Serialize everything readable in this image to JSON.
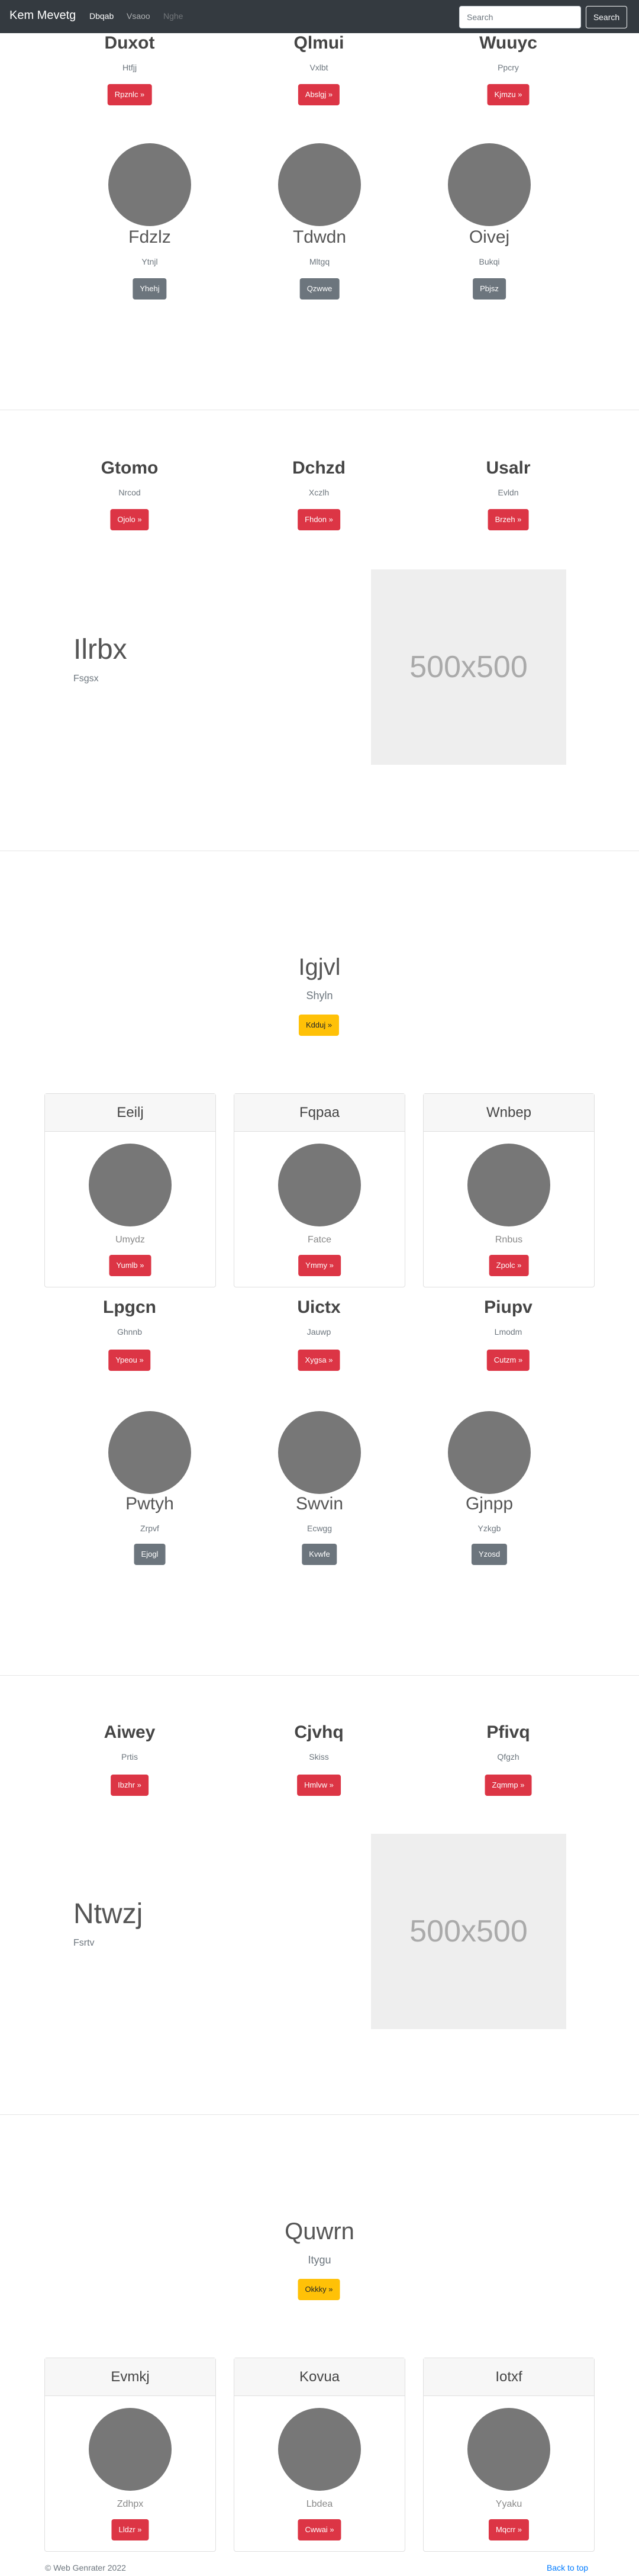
{
  "navbar": {
    "brand": "Kem Mevetg",
    "links": [
      "Dbqab",
      "Vsaoo",
      "Nghe"
    ],
    "search_placeholder": "Search",
    "search_button": "Search"
  },
  "section1_row1": [
    {
      "title": "Duxot",
      "sub": "Htfjj",
      "button": "Rpznlc »"
    },
    {
      "title": "Qlmui",
      "sub": "Vxlbt",
      "button": "Abslgj »"
    },
    {
      "title": "Wuuyc",
      "sub": "Ppcry",
      "button": "Kjmzu »"
    }
  ],
  "section1_row2": [
    {
      "title": "Fdzlz",
      "sub": "Ytnjl",
      "button": "Yhehj"
    },
    {
      "title": "Tdwdn",
      "sub": "Mltgq",
      "button": "Qzwwe"
    },
    {
      "title": "Oivej",
      "sub": "Bukqi",
      "button": "Pbjsz"
    }
  ],
  "section2_row": [
    {
      "title": "Gtomo",
      "sub": "Nrcod",
      "button": "Ojolo »"
    },
    {
      "title": "Dchzd",
      "sub": "Xczlh",
      "button": "Fhdon »"
    },
    {
      "title": "Usalr",
      "sub": "Evldn",
      "button": "Brzeh »"
    }
  ],
  "feature1": {
    "title": "Ilrbx",
    "sub": "Fsgsx",
    "placeholder": "500x500"
  },
  "hero1": {
    "title": "Igjvl",
    "sub": "Shyln",
    "button": "Kdduj »"
  },
  "cards1": [
    {
      "title": "Eeilj",
      "text": "Umydz",
      "button": "Yumlb »"
    },
    {
      "title": "Fqpaa",
      "text": "Fatce",
      "button": "Ymmy »"
    },
    {
      "title": "Wnbep",
      "text": "Rnbus",
      "button": "Zpolc »"
    }
  ],
  "section3_row1": [
    {
      "title": "Lpgcn",
      "sub": "Ghnnb",
      "button": "Ypeou »"
    },
    {
      "title": "Uictx",
      "sub": "Jauwp",
      "button": "Xygsa »"
    },
    {
      "title": "Piupv",
      "sub": "Lmodm",
      "button": "Cutzm »"
    }
  ],
  "section3_row2": [
    {
      "title": "Pwtyh",
      "sub": "Zrpvf",
      "button": "Ejogl"
    },
    {
      "title": "Swvin",
      "sub": "Ecwgg",
      "button": "Kvwfe"
    },
    {
      "title": "Gjnpp",
      "sub": "Yzkgb",
      "button": "Yzosd"
    }
  ],
  "section4_row": [
    {
      "title": "Aiwey",
      "sub": "Prtis",
      "button": "Ibzhr »"
    },
    {
      "title": "Cjvhq",
      "sub": "Skiss",
      "button": "Hmlvw »"
    },
    {
      "title": "Pfivq",
      "sub": "Qfgzh",
      "button": "Zqmmp »"
    }
  ],
  "feature2": {
    "title": "Ntwzj",
    "sub": "Fsrtv",
    "placeholder": "500x500"
  },
  "hero2": {
    "title": "Quwrn",
    "sub": "Itygu",
    "button": "Okkky »"
  },
  "cards2": [
    {
      "title": "Evmkj",
      "text": "Zdhpx",
      "button": "Lldzr »"
    },
    {
      "title": "Kovua",
      "text": "Lbdea",
      "button": "Cwwai »"
    },
    {
      "title": "Iotxf",
      "text": "Yyaku",
      "button": "Mqcrr »"
    }
  ],
  "footer": {
    "copyright": "© Web Genrater 2022",
    "back_to_top": "Back to top"
  },
  "colors": {
    "navbar": "#343a40",
    "danger": "#dc3545",
    "secondary": "#6c757d",
    "warning": "#ffc107",
    "link": "#007bff"
  }
}
